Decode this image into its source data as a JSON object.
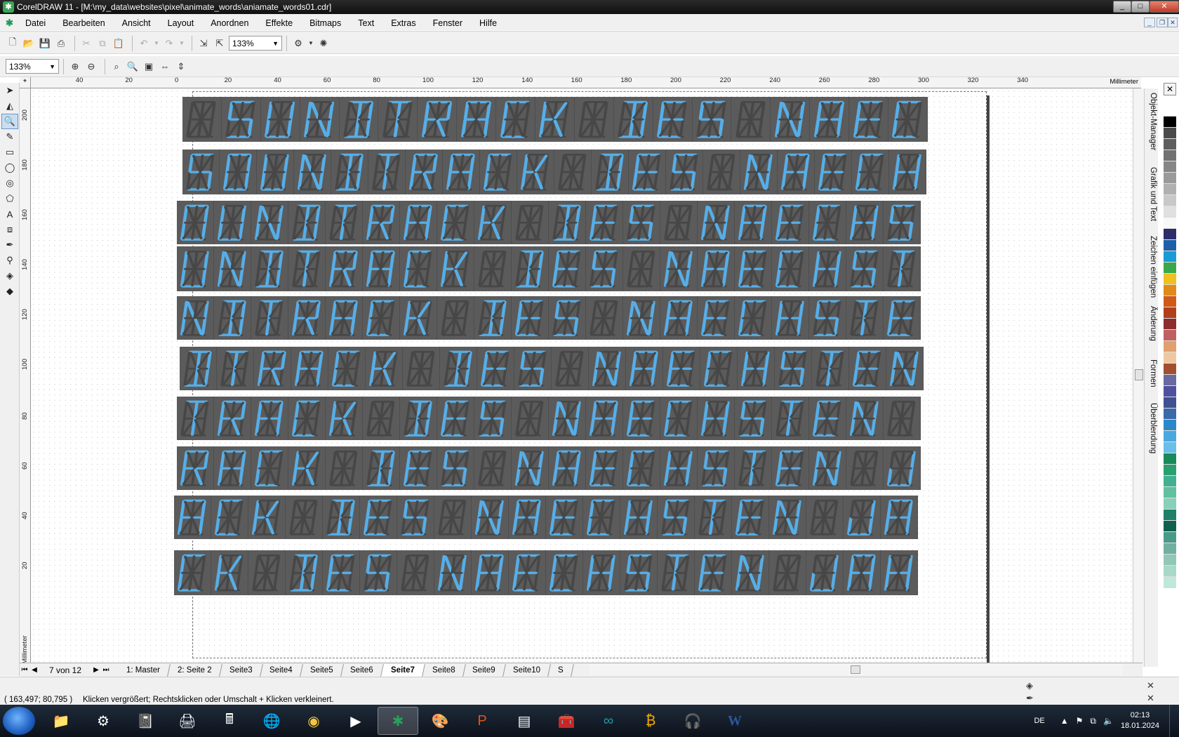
{
  "window": {
    "title": "CorelDRAW 11 - [M:\\my_data\\websites\\pixel\\animate_words\\aniamate_words01.cdr]",
    "controls": [
      "_",
      "□",
      "✕"
    ]
  },
  "menu": {
    "items": [
      "Datei",
      "Bearbeiten",
      "Ansicht",
      "Layout",
      "Anordnen",
      "Effekte",
      "Bitmaps",
      "Text",
      "Extras",
      "Fenster",
      "Hilfe"
    ]
  },
  "toolbar": {
    "zoom_value": "133%",
    "zoom_value_2": "133%"
  },
  "rulers": {
    "unit": "Millimeter",
    "h_labels": [
      "40",
      "20",
      "0",
      "20",
      "40",
      "60",
      "80",
      "100",
      "120",
      "140",
      "160",
      "180",
      "200",
      "220",
      "240",
      "260",
      "280",
      "300",
      "320",
      "340"
    ],
    "v_labels": [
      "200",
      "180",
      "160",
      "140",
      "120",
      "100",
      "80",
      "60",
      "40",
      "20"
    ],
    "v_unit": "Millimeter"
  },
  "display_rows": [
    {
      "offset": 8,
      "letters": [
        "0",
        "S",
        "U",
        "N",
        "D",
        "T",
        "R",
        "A",
        "C",
        "K",
        "0",
        "D",
        "E",
        "S",
        "0",
        "N",
        "A",
        "E",
        "C"
      ]
    },
    {
      "offset": 8,
      "letters": [
        "S",
        "O",
        "U",
        "N",
        "D",
        "T",
        "R",
        "A",
        "C",
        "K",
        "0",
        "D",
        "E",
        "S",
        "0",
        "N",
        "A",
        "E",
        "C",
        "H"
      ]
    },
    {
      "offset": 0,
      "letters": [
        "O",
        "U",
        "N",
        "D",
        "T",
        "R",
        "A",
        "C",
        "K",
        "0",
        "D",
        "E",
        "S",
        "0",
        "N",
        "A",
        "E",
        "C",
        "H",
        "S"
      ]
    },
    {
      "offset": 0,
      "letters": [
        "U",
        "N",
        "D",
        "T",
        "R",
        "A",
        "C",
        "K",
        "0",
        "D",
        "E",
        "S",
        "0",
        "N",
        "A",
        "E",
        "C",
        "H",
        "S",
        "T"
      ]
    },
    {
      "offset": 0,
      "letters": [
        "N",
        "D",
        "T",
        "R",
        "A",
        "C",
        "K",
        "0",
        "D",
        "E",
        "S",
        "0",
        "N",
        "A",
        "E",
        "C",
        "H",
        "S",
        "T",
        "E"
      ]
    },
    {
      "offset": 4,
      "letters": [
        "D",
        "T",
        "R",
        "A",
        "C",
        "K",
        "0",
        "D",
        "E",
        "S",
        "0",
        "N",
        "A",
        "E",
        "C",
        "H",
        "S",
        "T",
        "E",
        "N"
      ]
    },
    {
      "offset": 0,
      "letters": [
        "T",
        "R",
        "A",
        "C",
        "K",
        "0",
        "D",
        "E",
        "S",
        "0",
        "N",
        "A",
        "E",
        "C",
        "H",
        "S",
        "T",
        "E",
        "N",
        "0"
      ]
    },
    {
      "offset": 0,
      "letters": [
        "R",
        "A",
        "C",
        "K",
        "0",
        "D",
        "E",
        "S",
        "0",
        "N",
        "A",
        "E",
        "C",
        "H",
        "S",
        "T",
        "E",
        "N",
        "0",
        "J"
      ]
    },
    {
      "offset": -4,
      "letters": [
        "A",
        "C",
        "K",
        "0",
        "D",
        "E",
        "S",
        "0",
        "N",
        "A",
        "E",
        "C",
        "H",
        "S",
        "T",
        "E",
        "N",
        "0",
        "J",
        "A"
      ]
    },
    {
      "offset": -4,
      "letters": [
        "C",
        "K",
        "0",
        "D",
        "E",
        "S",
        "0",
        "N",
        "A",
        "E",
        "C",
        "H",
        "S",
        "T",
        "E",
        "N",
        "0",
        "J",
        "A",
        "H"
      ]
    }
  ],
  "dockers": [
    "Objekt-Manager",
    "Grafik und Text",
    "Zeichen einfügen",
    "Änderung",
    "Formen",
    "Überblendung"
  ],
  "palette": [
    "#ffffff",
    "#000000",
    "#4a4a4a",
    "#5e5e5e",
    "#727272",
    "#868686",
    "#9a9a9a",
    "#b0b0b0",
    "#c8c8c8",
    "#e0e0e0",
    "#f8f8f8",
    "#2d2d6b",
    "#1f5fa8",
    "#1a9ad6",
    "#3aa84a",
    "#f0c020",
    "#e08a1a",
    "#d05a1a",
    "#b0401a",
    "#8a2e2e",
    "#c06060",
    "#e0a070",
    "#f0c8a0",
    "#a05030",
    "#6a6aa0",
    "#5050a0",
    "#405090",
    "#3a6aa8",
    "#2a88c8",
    "#4aa8e0",
    "#68c0e8",
    "#1a8a5a",
    "#2aa070",
    "#40b090",
    "#60c0a0",
    "#88d0b8",
    "#20806a",
    "#106050",
    "#4a9a8a",
    "#70b0a0",
    "#90c8b8",
    "#a8d8c8",
    "#c0e8d8"
  ],
  "pagetabs": {
    "counter": "7 von 12",
    "tabs": [
      "1: Master",
      "2: Seite 2",
      "Seite3",
      "Seite4",
      "Seite5",
      "Seite6",
      "Seite7",
      "Seite8",
      "Seite9",
      "Seite10",
      "S"
    ],
    "active_index": 6
  },
  "status": {
    "coords": "( 163,497; 80,795 )",
    "hint": "Klicken vergrößert; Rechtsklicken oder Umschalt + Klicken verkleinert."
  },
  "taskbar": {
    "apps": [
      "explorer-icon",
      "settings-icon",
      "notebook-icon",
      "scanner-icon",
      "calculator-icon",
      "globe-icon",
      "chrome-icon",
      "media-icon",
      "coreldraw-icon",
      "paint-icon",
      "powerpoint-icon",
      "chart-icon",
      "toolbox-icon",
      "arduino-icon",
      "bitcoin-icon",
      "headset-icon",
      "word-icon"
    ],
    "active_app": "coreldraw-icon",
    "lang": "DE",
    "time": "02:13",
    "date": "18.01.2024"
  },
  "colors": {
    "segment_on": "#56aee8",
    "segment_off": "#474747",
    "row_bg": "#5b5b5b"
  }
}
